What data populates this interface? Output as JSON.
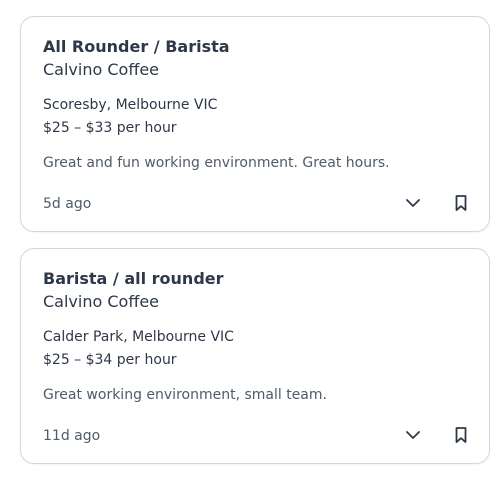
{
  "jobs": [
    {
      "title": "All Rounder / Barista",
      "company": "Calvino Coffee",
      "location": "Scoresby, Melbourne VIC",
      "salary": "$25 – $33 per hour",
      "description": "Great and fun working environment. Great hours.",
      "posted": "5d ago"
    },
    {
      "title": "Barista / all rounder",
      "company": "Calvino Coffee",
      "location": "Calder Park, Melbourne VIC",
      "salary": "$25 – $34 per hour",
      "description": "Great working environment, small team.",
      "posted": "11d ago"
    }
  ],
  "icons": {
    "expand": "chevron-down-icon",
    "save": "bookmark-icon"
  },
  "colors": {
    "text": "#2e3849",
    "muted": "#4f5a6b",
    "card_border": "#d2d7e0"
  }
}
